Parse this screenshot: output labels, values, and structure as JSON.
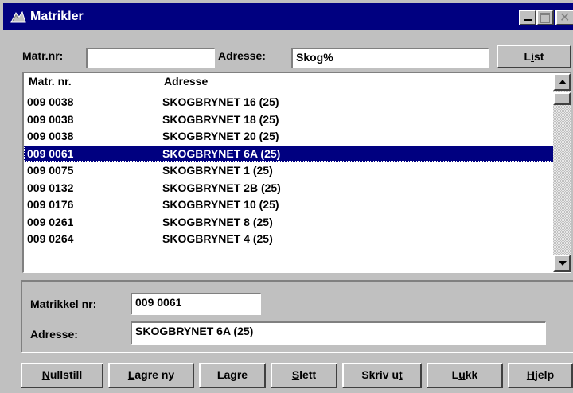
{
  "window": {
    "title": "Matrikler"
  },
  "search": {
    "matr_label": "Matr.nr:",
    "matr_value": "",
    "adresse_label": "Adresse:",
    "adresse_value": "Skog%",
    "list_button": "List"
  },
  "list": {
    "columns": [
      "Matr. nr.",
      "Adresse"
    ],
    "rows": [
      {
        "matr": "009 0038",
        "adresse": "SKOGBRYNET 16 (25)"
      },
      {
        "matr": "009 0038",
        "adresse": "SKOGBRYNET 18 (25)"
      },
      {
        "matr": "009 0038",
        "adresse": "SKOGBRYNET 20 (25)"
      },
      {
        "matr": "009 0061",
        "adresse": "SKOGBRYNET 6A (25)",
        "selected": true
      },
      {
        "matr": "009 0075",
        "adresse": "SKOGBRYNET 1 (25)"
      },
      {
        "matr": "009 0132",
        "adresse": "SKOGBRYNET 2B (25)"
      },
      {
        "matr": "009 0176",
        "adresse": "SKOGBRYNET 10 (25)"
      },
      {
        "matr": "009 0261",
        "adresse": "SKOGBRYNET 8 (25)"
      },
      {
        "matr": "009 0264",
        "adresse": "SKOGBRYNET 4 (25)"
      }
    ]
  },
  "detail": {
    "matrikkel_label": "Matrikkel nr:",
    "matrikkel_value": "009 0061",
    "adresse_label": "Adresse:",
    "adresse_value": "SKOGBRYNET 6A (25)"
  },
  "buttons": {
    "nullstill": {
      "mn": "N",
      "rest": "ullstill"
    },
    "lagre_ny": {
      "mn": "L",
      "rest": "agre ny"
    },
    "lagre": {
      "pre": "La",
      "mn": "g",
      "rest": "re"
    },
    "slett": {
      "mn": "S",
      "rest": "lett"
    },
    "skriv_ut": {
      "pre": "Skriv u",
      "mn": "t",
      "rest": ""
    },
    "lukk": {
      "pre": "L",
      "mn": "u",
      "rest": "kk"
    },
    "hjelp": {
      "mn": "H",
      "rest": "jelp"
    }
  },
  "colors": {
    "titlebar": "#000080",
    "selection": "#000080",
    "face": "#c0c0c0"
  }
}
